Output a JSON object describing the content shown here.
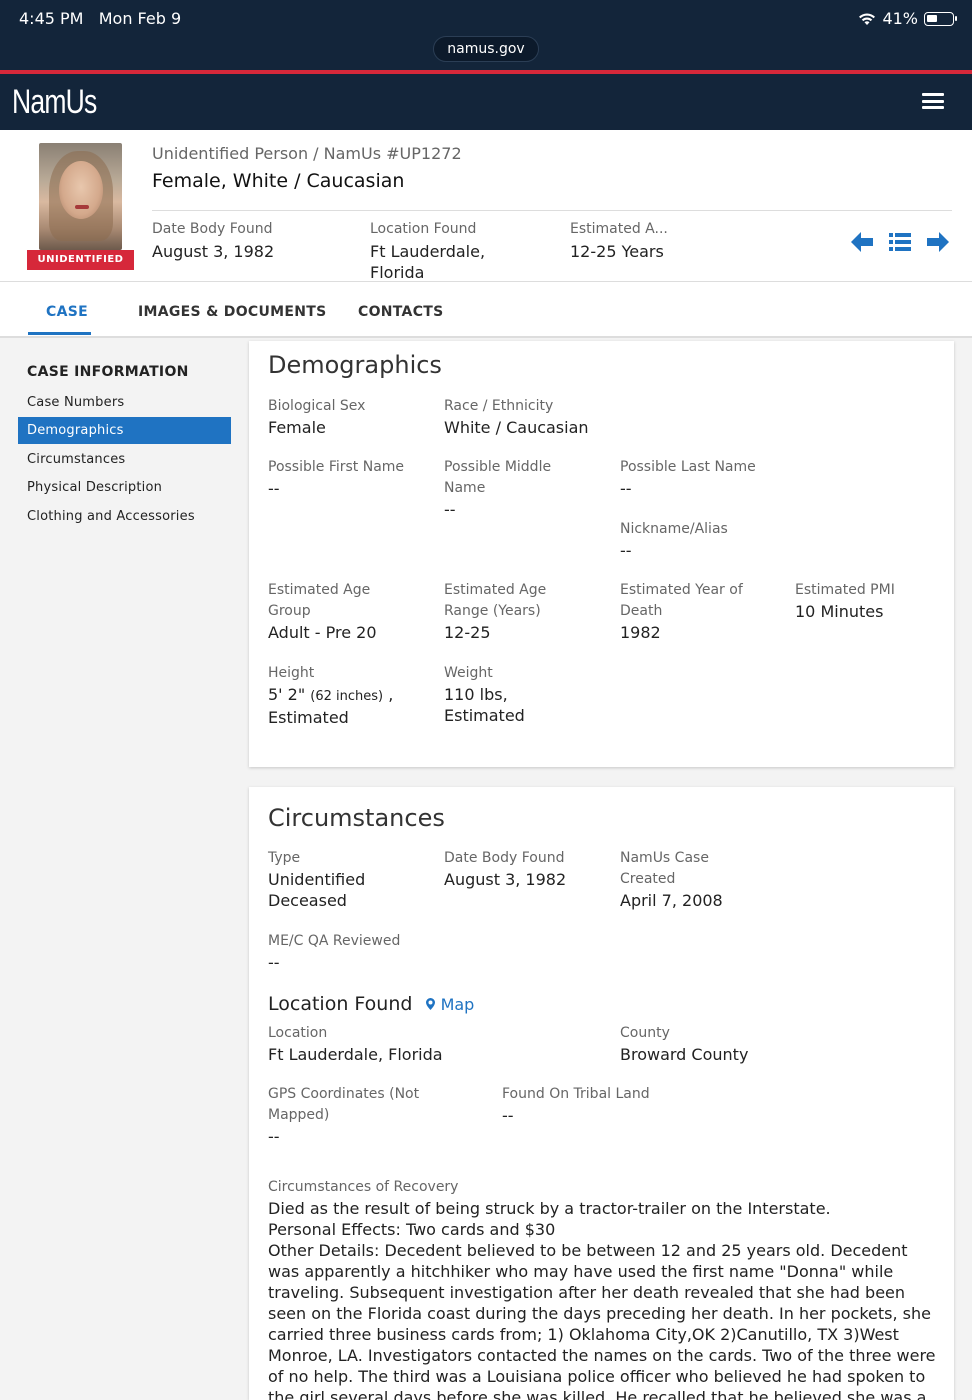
{
  "status": {
    "time": "4:45 PM",
    "date": "Mon Feb 9",
    "battery": "41%"
  },
  "browser": {
    "url": "namus.gov"
  },
  "header": {
    "logo": "NamUs"
  },
  "summary": {
    "badge": "UNIDENTIFIED",
    "kicker": "Unidentified Person / NamUs #UP1272",
    "title": "Female, White / Caucasian",
    "fields": [
      {
        "label": "Date Body Found",
        "value": "August 3, 1982"
      },
      {
        "label": "Location Found",
        "value": "Ft Lauderdale, Florida"
      },
      {
        "label": "Estimated A...",
        "value": "12-25 Years"
      }
    ]
  },
  "tabs": [
    {
      "label": "CASE"
    },
    {
      "label": "IMAGES & DOCUMENTS"
    },
    {
      "label": "CONTACTS"
    }
  ],
  "sidebar": {
    "heading": "CASE INFORMATION",
    "items": [
      {
        "label": "Case Numbers"
      },
      {
        "label": "Demographics"
      },
      {
        "label": "Circumstances"
      },
      {
        "label": "Physical Description"
      },
      {
        "label": "Clothing and Accessories"
      }
    ]
  },
  "demographics": {
    "title": "Demographics",
    "biological_sex": {
      "label": "Biological Sex",
      "value": "Female"
    },
    "race": {
      "label": "Race / Ethnicity",
      "value": "White / Caucasian"
    },
    "first_name": {
      "label": "Possible First Name",
      "value": "--"
    },
    "middle_name": {
      "label": "Possible Middle Name",
      "value": "--"
    },
    "last_name": {
      "label": "Possible Last Name",
      "value": "--"
    },
    "nickname": {
      "label": "Nickname/Alias",
      "value": "--"
    },
    "age_group": {
      "label": "Estimated Age Group",
      "value": "Adult - Pre 20"
    },
    "age_range": {
      "label": "Estimated Age Range (Years)",
      "value": "12-25"
    },
    "year_of_death": {
      "label": "Estimated Year of Death",
      "value": "1982"
    },
    "pmi": {
      "label": "Estimated PMI",
      "value": "10 Minutes"
    },
    "height": {
      "label": "Height",
      "value_main": "5' 2\"",
      "value_small": "(62 inches)",
      "value_tail": ", Estimated"
    },
    "weight": {
      "label": "Weight",
      "value": "110 lbs, Estimated"
    }
  },
  "circumstances": {
    "title": "Circumstances",
    "type": {
      "label": "Type",
      "value": "Unidentified Deceased"
    },
    "date_found": {
      "label": "Date Body Found",
      "value": "August 3, 1982"
    },
    "case_created": {
      "label": "NamUs Case Created",
      "value": "April 7, 2008"
    },
    "qa_reviewed": {
      "label": "ME/C QA Reviewed",
      "value": "--"
    },
    "location_heading": "Location Found",
    "map_link": "Map",
    "location": {
      "label": "Location",
      "value": "Ft Lauderdale, Florida"
    },
    "county": {
      "label": "County",
      "value": "Broward County"
    },
    "gps": {
      "label": "GPS Coordinates (Not Mapped)",
      "value": "--"
    },
    "tribal": {
      "label": "Found On Tribal Land",
      "value": "--"
    },
    "recovery": {
      "label": "Circumstances of Recovery",
      "value": "Died as the result of being struck by a tractor-trailer on the Interstate.\nPersonal Effects: Two cards and $30\nOther Details: Decedent believed to be between 12 and 25 years old. Decedent was apparently a hitchhiker who may have used the first name \"Donna\" while traveling. Subsequent investigation after her death revealed that she had been seen on the Florida coast during the days preceding her death. In her pockets, she carried three business cards from; 1) Oklahoma City,OK 2)Canutillo, TX 3)West Monroe, LA. Investigators contacted the names on the cards. Two of the three were of no help. The third was a Louisiana police officer who believed he had spoken to the girl several days before she was killed. He recalled that he believed she was a runaway and had"
    }
  },
  "colors": {
    "navy": "#13253a",
    "accent": "#1f73c2",
    "red": "#d6283a"
  }
}
